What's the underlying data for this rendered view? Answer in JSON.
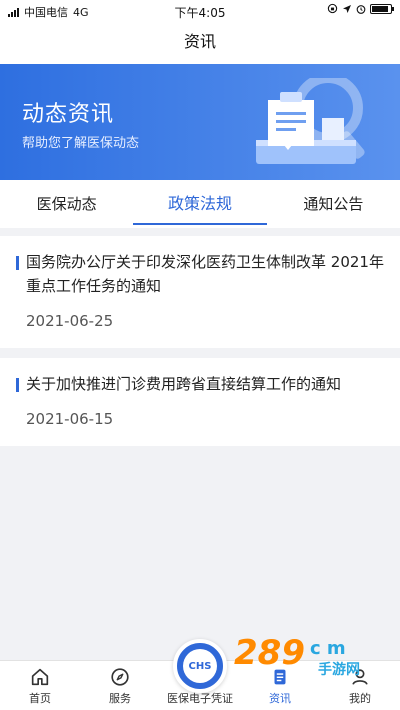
{
  "status_bar": {
    "carrier": "中国电信",
    "network": "4G",
    "time": "下午4:05",
    "battery_level": 0.9
  },
  "nav": {
    "title": "资讯"
  },
  "banner": {
    "title": "动态资讯",
    "subtitle": "帮助您了解医保动态"
  },
  "tabs": [
    {
      "label": "医保动态",
      "active": false
    },
    {
      "label": "政策法规",
      "active": true
    },
    {
      "label": "通知公告",
      "active": false
    }
  ],
  "articles": [
    {
      "title": "国务院办公厅关于印发深化医药卫生体制改革 2021年重点工作任务的通知",
      "date": "2021-06-25"
    },
    {
      "title": "关于加快推进门诊费用跨省直接结算工作的通知",
      "date": "2021-06-15"
    }
  ],
  "tabbar": {
    "home": "首页",
    "service": "服务",
    "card": "医保电子凭证",
    "card_badge": "CHS",
    "news": "资讯",
    "me": "我的"
  },
  "watermark": {
    "brand": "289",
    "suffix": "c m",
    "site": "手游网"
  },
  "colors": {
    "accent": "#2f68d8",
    "banner_start": "#2e6fe0",
    "banner_end": "#5a92ee"
  }
}
